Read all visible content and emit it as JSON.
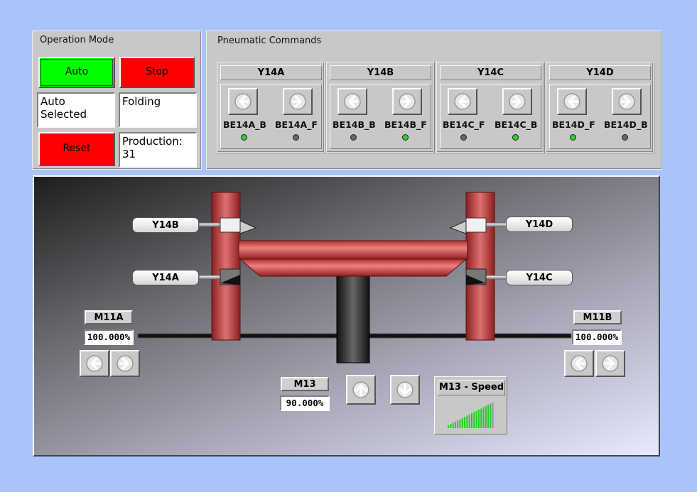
{
  "operation_mode": {
    "title": "Operation Mode",
    "auto_label": "Auto",
    "stop_label": "Stop",
    "reset_label": "Reset",
    "mode_status_line1": "Auto",
    "mode_status_line2": "Selected",
    "process_state": "Folding",
    "production_label": "Production:",
    "production_value": "31",
    "colors": {
      "auto": "#00ff00",
      "stop": "#ff0000",
      "reset": "#ff0000"
    }
  },
  "pneumatic": {
    "title": "Pneumatic Commands",
    "groups": [
      {
        "name": "Y14A",
        "left_label": "BE14A_B",
        "right_label": "BE14A_F",
        "left_led": "on",
        "right_led": "off"
      },
      {
        "name": "Y14B",
        "left_label": "BE14B_B",
        "right_label": "BE14B_F",
        "left_led": "off",
        "right_led": "on"
      },
      {
        "name": "Y14C",
        "left_label": "BE14C_F",
        "right_label": "BE14C_B",
        "left_led": "off",
        "right_led": "on"
      },
      {
        "name": "Y14D",
        "left_label": "BE14D_F",
        "right_label": "BE14D_B",
        "left_led": "on",
        "right_led": "off"
      }
    ],
    "icons": {
      "left": "arrow-left-icon",
      "right": "arrow-right-icon"
    }
  },
  "machine": {
    "cylinders": {
      "y14b": "Y14B",
      "y14a": "Y14A",
      "y14d": "Y14D",
      "y14c": "Y14C"
    },
    "m11a": {
      "label": "M11A",
      "value": "100.000%"
    },
    "m11b": {
      "label": "M11B",
      "value": "100.000%"
    },
    "m13": {
      "label": "M13",
      "value": "90.000%"
    },
    "m13_speed": {
      "title": "M13 - Speed",
      "level": 0.9
    },
    "icons": {
      "up": "arrow-up-icon",
      "down": "arrow-down-icon"
    }
  }
}
